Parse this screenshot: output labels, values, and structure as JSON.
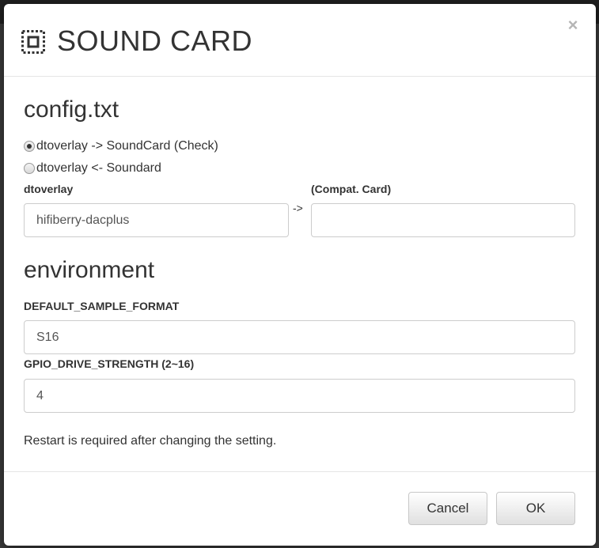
{
  "modal": {
    "title": "SOUND CARD",
    "close_label": "×"
  },
  "config": {
    "heading": "config.txt",
    "radios": [
      {
        "label": "dtoverlay -> SoundCard (Check)",
        "checked": true
      },
      {
        "label": "dtoverlay <- Soundard",
        "checked": false
      }
    ],
    "dtoverlay_label": "dtoverlay",
    "dtoverlay_value": "hifiberry-dacplus",
    "arrow": "->",
    "compat_label": "(Compat. Card)",
    "compat_value": ""
  },
  "environment": {
    "heading": "environment",
    "sample_format_label": "DEFAULT_SAMPLE_FORMAT",
    "sample_format_value": "S16",
    "gpio_label": "GPIO_DRIVE_STRENGTH (2~16)",
    "gpio_value": "4"
  },
  "note": "Restart is required after changing the setting.",
  "footer": {
    "cancel_label": "Cancel",
    "ok_label": "OK"
  },
  "icons": {
    "title_icon": "chip-icon",
    "close_icon": "close-icon"
  }
}
